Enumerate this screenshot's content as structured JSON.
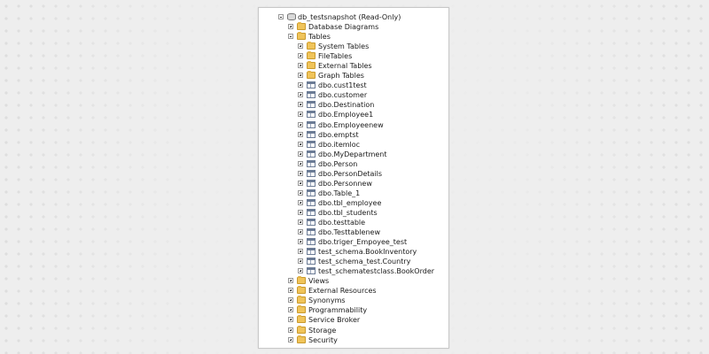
{
  "tree": {
    "root": {
      "label": "db_testsnapshot (Read-Only)",
      "icon": "database-snapshot-icon"
    },
    "top_folders_before": [
      {
        "label": "Database Diagrams"
      }
    ],
    "tables_folder": {
      "label": "Tables"
    },
    "table_subfolders": [
      {
        "label": "System Tables"
      },
      {
        "label": "FileTables"
      },
      {
        "label": "External Tables"
      },
      {
        "label": "Graph Tables"
      }
    ],
    "tables": [
      {
        "label": "dbo.cust1test"
      },
      {
        "label": "dbo.customer"
      },
      {
        "label": "dbo.Destination"
      },
      {
        "label": "dbo.Employee1"
      },
      {
        "label": "dbo.Employeenew"
      },
      {
        "label": "dbo.emptst"
      },
      {
        "label": "dbo.itemloc"
      },
      {
        "label": "dbo.MyDepartment"
      },
      {
        "label": "dbo.Person"
      },
      {
        "label": "dbo.PersonDetails"
      },
      {
        "label": "dbo.Personnew"
      },
      {
        "label": "dbo.Table_1"
      },
      {
        "label": "dbo.tbl_employee"
      },
      {
        "label": "dbo.tbl_students"
      },
      {
        "label": "dbo.testtable"
      },
      {
        "label": "dbo.Testtablenew"
      },
      {
        "label": "dbo.triger_Empoyee_test"
      },
      {
        "label": "test_schema.BookInventory"
      },
      {
        "label": "test_schema_test.Country"
      },
      {
        "label": "test_schematestclass.BookOrder"
      }
    ],
    "top_folders_after": [
      {
        "label": "Views"
      },
      {
        "label": "External Resources"
      },
      {
        "label": "Synonyms"
      },
      {
        "label": "Programmability"
      },
      {
        "label": "Service Broker"
      },
      {
        "label": "Storage"
      },
      {
        "label": "Security"
      }
    ]
  }
}
